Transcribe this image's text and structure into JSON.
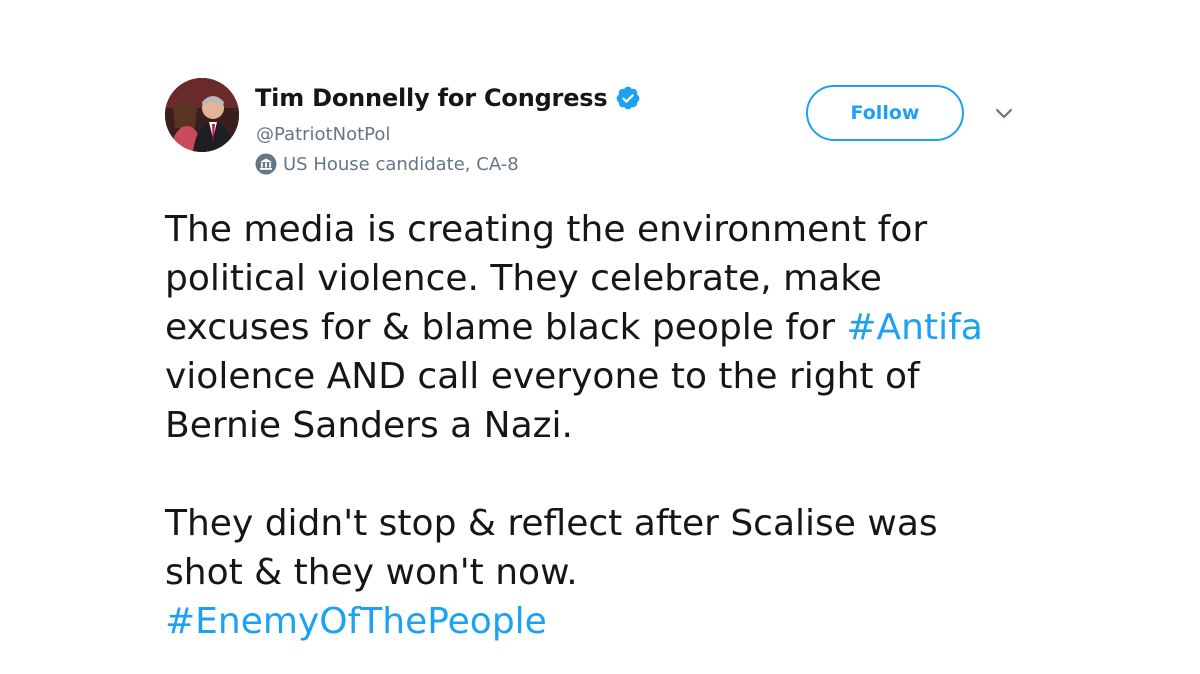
{
  "account": {
    "display_name": "Tim Donnelly for Congress",
    "handle": "@PatriotNotPol",
    "label": "US House candidate, CA-8",
    "verified": true
  },
  "actions": {
    "follow_label": "Follow"
  },
  "tweet": {
    "para1": {
      "line1": "The media is creating the environment for",
      "line2": "political violence. They celebrate, make",
      "line3_text": "excuses for & blame black people for ",
      "line3_hashtag": "#Antifa",
      "line4": "violence AND call everyone to the right of",
      "line5": "Bernie Sanders a Nazi."
    },
    "para2": {
      "line1": "They didn't stop & reflect after Scalise was",
      "line2": "shot & they won't now.",
      "hashtag": "#EnemyOfThePeople"
    }
  },
  "colors": {
    "accent": "#1da1f2",
    "text": "#14171a",
    "secondary": "#657786"
  },
  "icons": {
    "verified": "verified-badge-icon",
    "label": "government-building-icon",
    "menu": "chevron-down-icon"
  }
}
